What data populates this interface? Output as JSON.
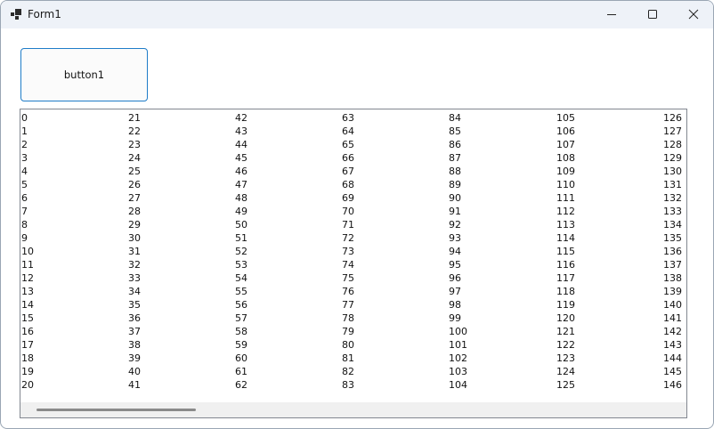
{
  "window": {
    "title": "Form1",
    "controls": {
      "minimize_icon": "minimize-icon",
      "maximize_icon": "maximize-icon",
      "close_icon": "close-icon"
    }
  },
  "button1": {
    "label": "button1",
    "border_color": "#1f7cc8"
  },
  "listbox": {
    "columns": [
      [
        "0",
        "1",
        "2",
        "3",
        "4",
        "5",
        "6",
        "7",
        "8",
        "9",
        "10",
        "11",
        "12",
        "13",
        "14",
        "15",
        "16",
        "17",
        "18",
        "19",
        "20"
      ],
      [
        "21",
        "22",
        "23",
        "24",
        "25",
        "26",
        "27",
        "28",
        "29",
        "30",
        "31",
        "32",
        "33",
        "34",
        "35",
        "36",
        "37",
        "38",
        "39",
        "40",
        "41"
      ],
      [
        "42",
        "43",
        "44",
        "45",
        "46",
        "47",
        "48",
        "49",
        "50",
        "51",
        "52",
        "53",
        "54",
        "55",
        "56",
        "57",
        "58",
        "59",
        "60",
        "61",
        "62"
      ],
      [
        "63",
        "64",
        "65",
        "66",
        "67",
        "68",
        "69",
        "70",
        "71",
        "72",
        "73",
        "74",
        "75",
        "76",
        "77",
        "78",
        "79",
        "80",
        "81",
        "82",
        "83"
      ],
      [
        "84",
        "85",
        "86",
        "87",
        "88",
        "89",
        "90",
        "91",
        "92",
        "93",
        "94",
        "95",
        "96",
        "97",
        "98",
        "99",
        "100",
        "101",
        "102",
        "103",
        "104"
      ],
      [
        "105",
        "106",
        "107",
        "108",
        "109",
        "110",
        "111",
        "112",
        "113",
        "114",
        "115",
        "116",
        "117",
        "118",
        "119",
        "120",
        "121",
        "122",
        "123",
        "124",
        "125"
      ],
      [
        "126",
        "127",
        "128",
        "129",
        "130",
        "131",
        "132",
        "133",
        "134",
        "135",
        "136",
        "137",
        "138",
        "139",
        "140",
        "141",
        "142",
        "143",
        "144",
        "145",
        "146"
      ]
    ]
  }
}
